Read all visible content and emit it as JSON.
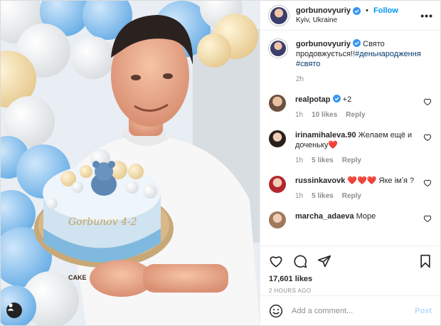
{
  "header": {
    "username": "gorbunovyuriy",
    "separator": "•",
    "follow_label": "Follow",
    "location": "Kyiv, Ukraine",
    "more_label": "•••"
  },
  "caption": {
    "username": "gorbunovyuriy",
    "text": "Свято продовжується!!",
    "hashtag1": "#деньнародження",
    "hashtag2": "#свято",
    "age": "2h"
  },
  "comments": [
    {
      "username": "realpotap",
      "text": "+2",
      "age": "1h",
      "likes": "10 likes",
      "reply": "Reply",
      "verified": true
    },
    {
      "username": "irinamihaleva.90",
      "text": "Желаем ещё и доченьку❤️",
      "age": "1h",
      "likes": "5 likes",
      "reply": "Reply"
    },
    {
      "username": "russinkavovk",
      "text": "❤️❤️❤️ Яке імʼя ?",
      "age": "1h",
      "likes": "5 likes",
      "reply": "Reply"
    },
    {
      "username": "marcha_adaeva",
      "text": "Море"
    }
  ],
  "actions": {
    "likes_count": "17,601 likes",
    "timestamp": "2 HOURS AGO"
  },
  "add_comment": {
    "placeholder": "Add a comment...",
    "post_label": "Post"
  },
  "colors": {
    "link_blue": "#0095f6",
    "hashtag": "#00376b",
    "muted": "#8e8e8e",
    "post_disabled": "#b3dbff"
  },
  "photo": {
    "cake_text": "CAKE"
  }
}
